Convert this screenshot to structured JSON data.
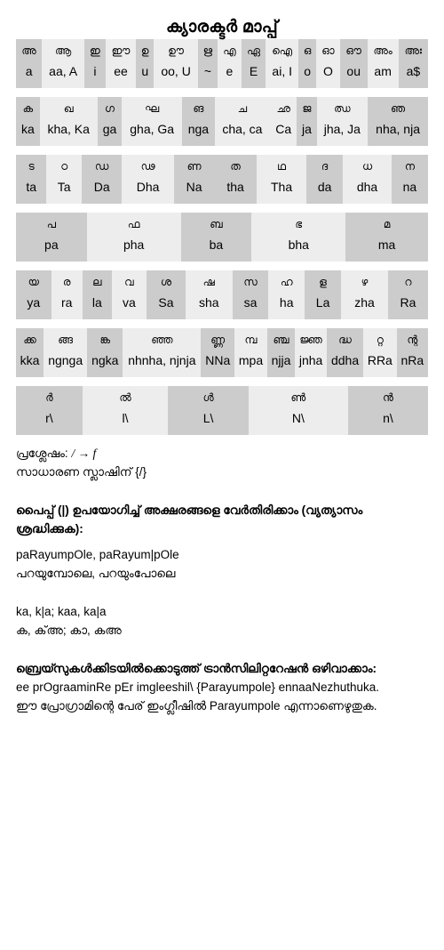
{
  "title": "ക്യാരക്ടർ മാപ്പ്",
  "tables": [
    {
      "name": "vowels",
      "columns": [
        {
          "glyph": "അ",
          "roman": "a",
          "shade": "a"
        },
        {
          "glyph": "ആ",
          "roman": "aa, A",
          "shade": "b"
        },
        {
          "glyph": "ഇ",
          "roman": "i",
          "shade": "a"
        },
        {
          "glyph": "ഈ",
          "roman": "ee",
          "shade": "b"
        },
        {
          "glyph": "ഉ",
          "roman": "u",
          "shade": "a"
        },
        {
          "glyph": "ഊ",
          "roman": "oo, U",
          "shade": "b"
        },
        {
          "glyph": "ഋ",
          "roman": "~",
          "shade": "a"
        },
        {
          "glyph": "എ",
          "roman": "e",
          "shade": "b"
        },
        {
          "glyph": "ഏ",
          "roman": "E",
          "shade": "a"
        },
        {
          "glyph": "ഐ",
          "roman": "ai, I",
          "shade": "b"
        },
        {
          "glyph": "ഒ",
          "roman": "o",
          "shade": "a"
        },
        {
          "glyph": "ഓ",
          "roman": "O",
          "shade": "b"
        },
        {
          "glyph": "ഔ",
          "roman": "ou",
          "shade": "a"
        },
        {
          "glyph": "അം",
          "roman": "am",
          "shade": "b"
        },
        {
          "glyph": "അഃ",
          "roman": "a$",
          "shade": "a"
        }
      ]
    },
    {
      "name": "ka-varga",
      "columns": [
        {
          "glyph": "ക",
          "roman": "ka",
          "shade": "a"
        },
        {
          "glyph": "ഖ",
          "roman": "kha, Ka",
          "shade": "b"
        },
        {
          "glyph": "ഗ",
          "roman": "ga",
          "shade": "a"
        },
        {
          "glyph": "ഘ",
          "roman": "gha, Ga",
          "shade": "b"
        },
        {
          "glyph": "ങ",
          "roman": "nga",
          "shade": "a"
        },
        {
          "glyph": "ച",
          "roman": "cha, ca",
          "shade": "b"
        },
        {
          "glyph": "ഛ",
          "roman": "Ca",
          "shade": "b"
        },
        {
          "glyph": "ജ",
          "roman": "ja",
          "shade": "a"
        },
        {
          "glyph": "ഝ",
          "roman": "jha, Ja",
          "shade": "b"
        },
        {
          "glyph": "ഞ",
          "roman": "nha, nja",
          "shade": "a"
        }
      ]
    },
    {
      "name": "ta-varga",
      "columns": [
        {
          "glyph": "ട",
          "roman": "ta",
          "shade": "a"
        },
        {
          "glyph": "ഠ",
          "roman": "Ta",
          "shade": "b"
        },
        {
          "glyph": "ഡ",
          "roman": "Da",
          "shade": "a"
        },
        {
          "glyph": "ഢ",
          "roman": "Dha",
          "shade": "b"
        },
        {
          "glyph": "ണ",
          "roman": "Na",
          "shade": "a"
        },
        {
          "glyph": "ത",
          "roman": "tha",
          "shade": "a"
        },
        {
          "glyph": "ഥ",
          "roman": "Tha",
          "shade": "b"
        },
        {
          "glyph": "ദ",
          "roman": "da",
          "shade": "a"
        },
        {
          "glyph": "ധ",
          "roman": "dha",
          "shade": "b"
        },
        {
          "glyph": "ന",
          "roman": "na",
          "shade": "a"
        }
      ]
    },
    {
      "name": "pa-varga",
      "columns": [
        {
          "glyph": "പ",
          "roman": "pa",
          "shade": "a"
        },
        {
          "glyph": "ഫ",
          "roman": "pha",
          "shade": "b"
        },
        {
          "glyph": "ബ",
          "roman": "ba",
          "shade": "a"
        },
        {
          "glyph": "ഭ",
          "roman": "bha",
          "shade": "b"
        },
        {
          "glyph": "മ",
          "roman": "ma",
          "shade": "a"
        }
      ]
    },
    {
      "name": "ya-varga",
      "columns": [
        {
          "glyph": "യ",
          "roman": "ya",
          "shade": "a"
        },
        {
          "glyph": "ര",
          "roman": "ra",
          "shade": "b"
        },
        {
          "glyph": "ല",
          "roman": "la",
          "shade": "a"
        },
        {
          "glyph": "വ",
          "roman": "va",
          "shade": "b"
        },
        {
          "glyph": "ശ",
          "roman": "Sa",
          "shade": "a"
        },
        {
          "glyph": "ഷ",
          "roman": "sha",
          "shade": "b"
        },
        {
          "glyph": "സ",
          "roman": "sa",
          "shade": "a"
        },
        {
          "glyph": "ഹ",
          "roman": "ha",
          "shade": "b"
        },
        {
          "glyph": "ള",
          "roman": "La",
          "shade": "a"
        },
        {
          "glyph": "ഴ",
          "roman": "zha",
          "shade": "b"
        },
        {
          "glyph": "റ",
          "roman": "Ra",
          "shade": "a"
        }
      ]
    },
    {
      "name": "conjuncts",
      "columns": [
        {
          "glyph": "ക്ക",
          "roman": "kka",
          "shade": "a"
        },
        {
          "glyph": "ങ്ങ",
          "roman": "ngnga",
          "shade": "b"
        },
        {
          "glyph": "ങ്ക",
          "roman": "ngka",
          "shade": "a"
        },
        {
          "glyph": "ഞ്ഞ",
          "roman": "nhnha, njnja",
          "shade": "b"
        },
        {
          "glyph": "ണ്ണ",
          "roman": "NNa",
          "shade": "a"
        },
        {
          "glyph": "മ്പ",
          "roman": "mpa",
          "shade": "b"
        },
        {
          "glyph": "ഞ്ച",
          "roman": "njja",
          "shade": "a"
        },
        {
          "glyph": "ജ്ഞ",
          "roman": "jnha",
          "shade": "b"
        },
        {
          "glyph": "ദ്ധ",
          "roman": "ddha",
          "shade": "a"
        },
        {
          "glyph": "റ്റ",
          "roman": "RRa",
          "shade": "b"
        },
        {
          "glyph": "ന്റ",
          "roman": "nRa",
          "shade": "a"
        }
      ]
    },
    {
      "name": "chillus",
      "columns": [
        {
          "glyph": "ർ",
          "roman": "r\\",
          "shade": "a"
        },
        {
          "glyph": "ൽ",
          "roman": "l\\",
          "shade": "b"
        },
        {
          "glyph": "ൾ",
          "roman": "L\\",
          "shade": "a"
        },
        {
          "glyph": "ൺ",
          "roman": "N\\",
          "shade": "b"
        },
        {
          "glyph": "ൻ",
          "roman": "n\\",
          "shade": "a"
        }
      ]
    }
  ],
  "notes": {
    "special_label": "പ്രശ്ലേഷം:",
    "special_mapping": "/ → f",
    "slash_line": "സാധാരണ സ്ലാഷിന് {/}",
    "pipe_heading_1": "പൈപ്പ് (|) ഉപയോഗിച്ച് അക്ഷരങ്ങളെ വേർതിരിക്കാം (വ്യത്യാസം",
    "pipe_heading_2": "ശ്രദ്ധിക്കുക):",
    "pipe_example_roman": "paRayumpOle, paRayum|pOle",
    "pipe_example_mal": "പറയുമ്പോലെ, പറയുംപോലെ",
    "ka_example_roman": "ka, k|a; kaa, ka|a",
    "ka_example_mal": "ക, ക്‌അ; കാ, കഅ",
    "braces_heading": "ബ്രെയ്സുകൾക്കിടയിൽക്കൊടുത്ത് ട്രാൻസിലിറ്ററേഷൻ ഒഴിവാക്കാം:",
    "braces_example_roman": "ee prOgraaminRe pEr imgleeshil\\ {Parayumpole} ennaaNezhuthuka.",
    "braces_example_mal": "ഈ പ്രോഗ്രാമിന്റെ പേര് ഇംഗ്ലീഷിൽ Parayumpole എന്നാണെഴുതുക."
  },
  "colors": {
    "shade_a": "#cccccc",
    "shade_b": "#ededed",
    "background": "#ffffff",
    "text": "#000000"
  }
}
